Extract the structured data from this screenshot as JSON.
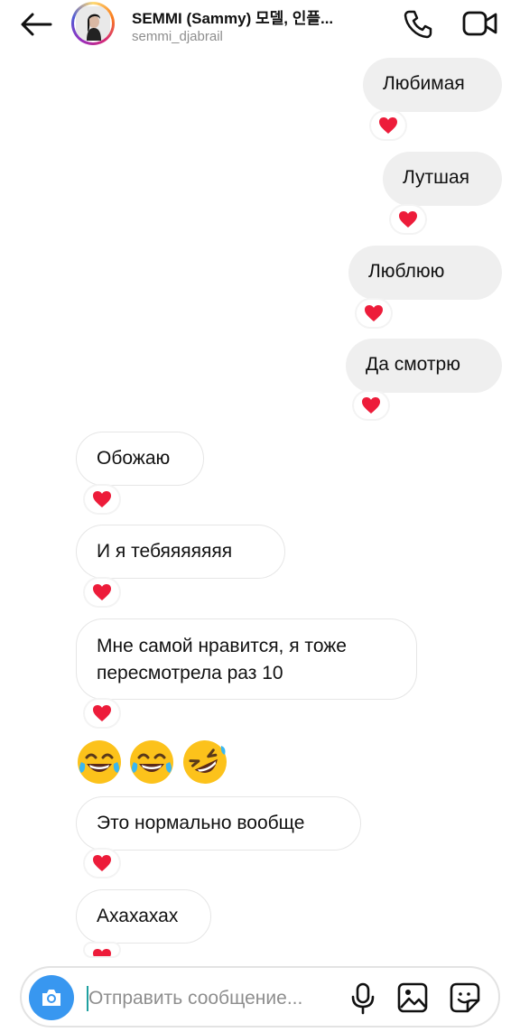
{
  "header": {
    "name": "SEMMI (Sammy) 모델, 인플...",
    "handle": "semmi_djabrail",
    "icons": [
      "back-arrow-icon",
      "phone-icon",
      "video-camera-icon"
    ]
  },
  "messages": [
    {
      "text": "Любимая",
      "from": "me",
      "reaction": "❤"
    },
    {
      "text": "Лутшая",
      "from": "me",
      "reaction": "❤"
    },
    {
      "text": "Люблюю",
      "from": "me",
      "reaction": "❤"
    },
    {
      "text": "Да смотрю",
      "from": "me",
      "reaction": "❤"
    },
    {
      "text": "Обожаю",
      "from": "them",
      "reaction": "❤"
    },
    {
      "text": "И я тебяяяяяяя",
      "from": "them",
      "reaction": "❤"
    },
    {
      "text": "Мне самой нравится, я тоже пересмотрела раз 10",
      "from": "them",
      "reaction": "❤"
    },
    {
      "text": "Это нормально вообще",
      "from": "them",
      "reaction": "❤"
    },
    {
      "text": "Ахахахах",
      "from": "them",
      "reaction": "❤"
    }
  ],
  "emoji_message": [
    "joy-emoji",
    "joy-emoji",
    "rofl-emoji"
  ],
  "composer": {
    "placeholder": "Отправить сообщение...",
    "icons": [
      "camera-icon",
      "microphone-icon",
      "gallery-icon",
      "sticker-icon"
    ]
  },
  "colors": {
    "heart": "#ed1c3a",
    "camera_button": "#3897f0",
    "incoming_bubble": "#ffffff",
    "outgoing_bubble": "#efefef"
  }
}
